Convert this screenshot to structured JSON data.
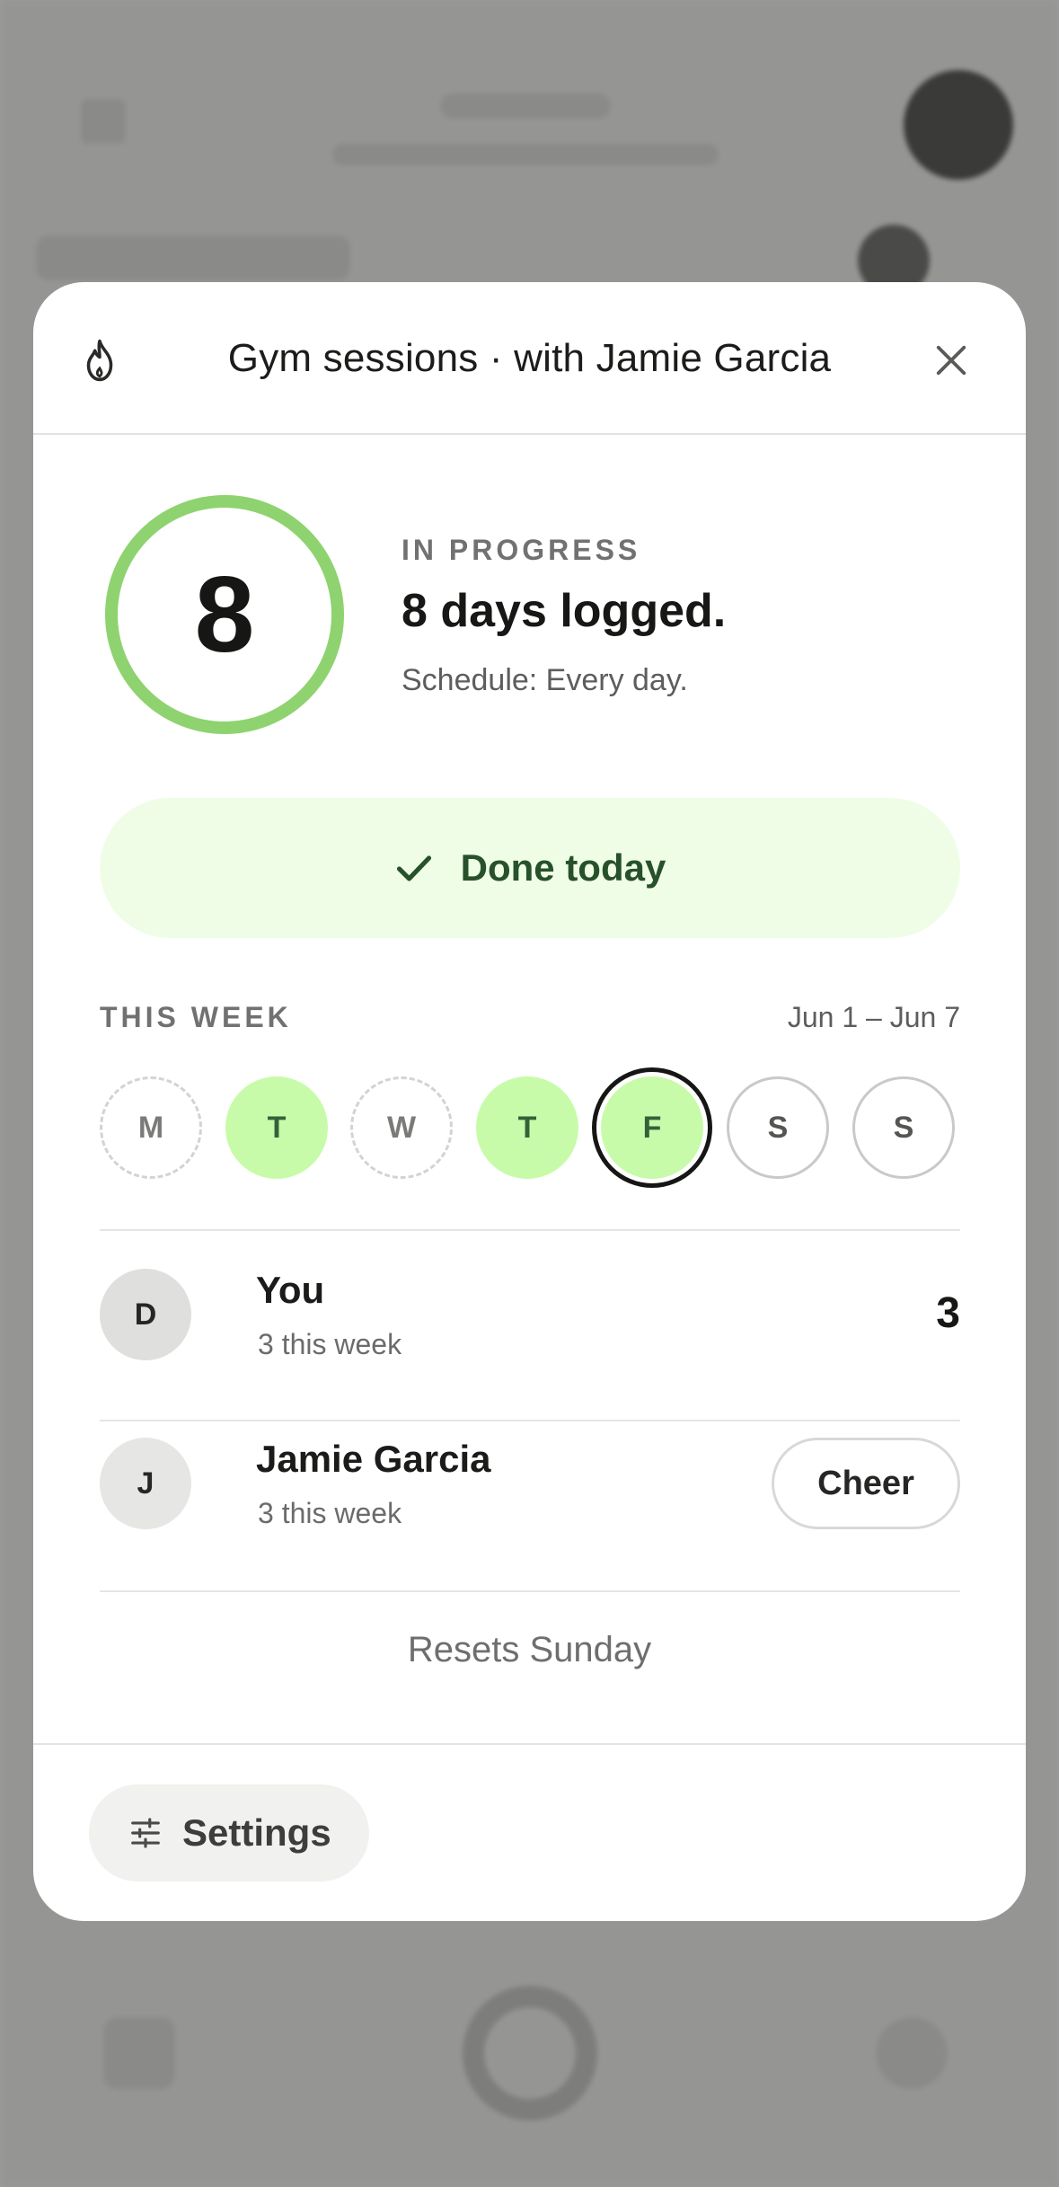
{
  "modal": {
    "title": "Gym sessions · with Jamie Garcia",
    "icons": {
      "header": "flame-icon",
      "close": "close-icon",
      "done": "check-icon",
      "settings": "sliders-icon"
    },
    "progress": {
      "count": "8",
      "ring_color": "#8ed36f"
    },
    "status": {
      "label": "IN PROGRESS",
      "headline": "8 days logged.",
      "schedule": "Schedule: Every day."
    },
    "done_button": {
      "label": "Done today"
    },
    "week": {
      "label": "THIS WEEK",
      "range": "Jun 1 – Jun 7",
      "days": [
        {
          "letter": "M",
          "state": "missed"
        },
        {
          "letter": "T",
          "state": "done"
        },
        {
          "letter": "W",
          "state": "missed"
        },
        {
          "letter": "T",
          "state": "done"
        },
        {
          "letter": "F",
          "state": "today"
        },
        {
          "letter": "S",
          "state": "future"
        },
        {
          "letter": "S",
          "state": "future"
        }
      ]
    },
    "members": [
      {
        "initial": "D",
        "name": "You",
        "sub": "3 this week",
        "count": "3"
      },
      {
        "initial": "J",
        "name": "Jamie Garcia",
        "sub": "3 this week",
        "action": "Cheer"
      }
    ],
    "resets": "Resets Sunday",
    "settings_label": "Settings"
  },
  "colors": {
    "accent_green": "#c8fba9",
    "done_bg": "#effde6",
    "done_text": "#27512a"
  }
}
